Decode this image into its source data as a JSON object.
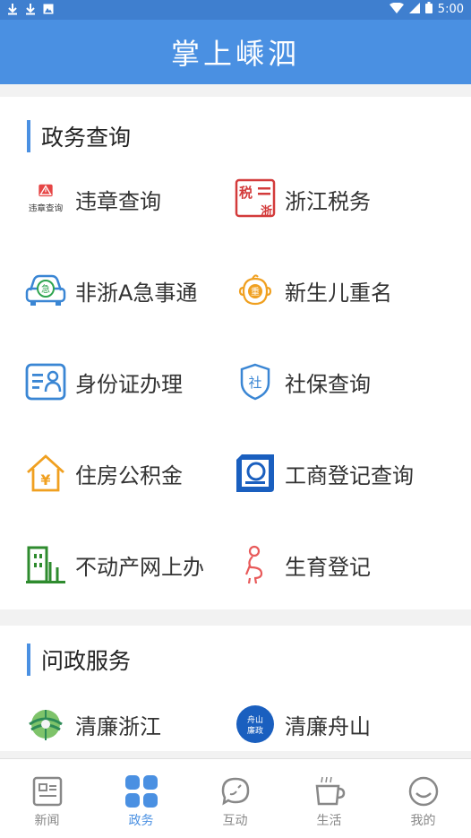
{
  "status_bar": {
    "time": "5:00"
  },
  "app": {
    "title": "掌上嵊泗"
  },
  "gov_section": {
    "title": "政务查询",
    "items": [
      {
        "label": "违章查询",
        "icon": "traffic-violation-icon",
        "icon_caption": "违章查询"
      },
      {
        "label": "浙江税务",
        "icon": "tax-icon",
        "icon_text_top": "税",
        "icon_text_bottom": "浙"
      },
      {
        "label": "非浙A急事通",
        "icon": "car-icon",
        "icon_text": "急"
      },
      {
        "label": "新生儿重名",
        "icon": "baby-icon",
        "icon_text": "重"
      },
      {
        "label": "身份证办理",
        "icon": "id-card-icon"
      },
      {
        "label": "社保查询",
        "icon": "social-security-icon",
        "icon_text": "社"
      },
      {
        "label": "住房公积金",
        "icon": "house-fund-icon",
        "icon_text": "¥"
      },
      {
        "label": "工商登记查询",
        "icon": "business-registration-icon"
      },
      {
        "label": "不动产网上办",
        "icon": "building-icon"
      },
      {
        "label": "生育登记",
        "icon": "pregnancy-icon"
      }
    ]
  },
  "ask_section": {
    "title": "问政服务",
    "items": [
      {
        "label": "清廉浙江",
        "icon": "zhejiang-logo-icon"
      },
      {
        "label": "清廉舟山",
        "icon": "zhoushan-logo-icon",
        "icon_text_top": "舟山",
        "icon_text_bottom": "廉政"
      }
    ]
  },
  "tabs": [
    {
      "label": "新闻",
      "icon": "news-icon",
      "active": false
    },
    {
      "label": "政务",
      "icon": "gov-grid-icon",
      "active": true
    },
    {
      "label": "互动",
      "icon": "chat-icon",
      "active": false
    },
    {
      "label": "生活",
      "icon": "coffee-icon",
      "active": false
    },
    {
      "label": "我的",
      "icon": "smile-icon",
      "active": false
    }
  ],
  "colors": {
    "primary": "#4a90e2",
    "status_bar": "#3f7fcf"
  }
}
